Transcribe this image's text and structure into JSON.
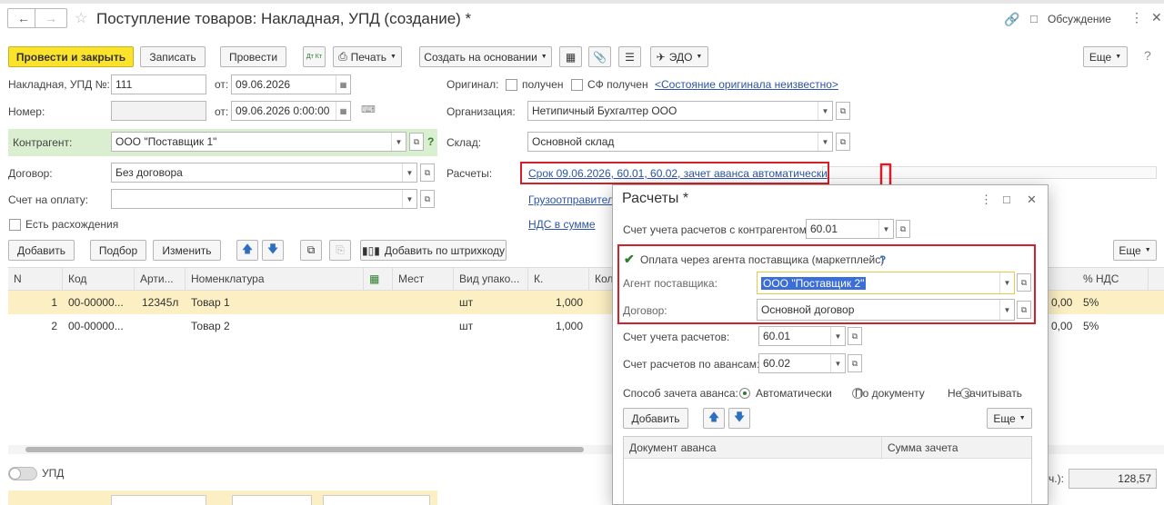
{
  "header": {
    "title": "Поступление товаров: Накладная, УПД (создание) *",
    "discussion": "Обсуждение"
  },
  "toolbar": {
    "post_close": "Провести и закрыть",
    "save": "Записать",
    "post": "Провести",
    "print": "Печать",
    "create_based": "Создать на основании",
    "edo": "ЭДО",
    "more": "Еще",
    "dtkt": "Дт Кт"
  },
  "form": {
    "invoice_label": "Накладная, УПД №:",
    "invoice_value": "111",
    "from_label": "от:",
    "invoice_date": "09.06.2026",
    "number_label": "Номер:",
    "number_value": "",
    "number_date": "09.06.2026  0:00:00",
    "original_label": "Оригинал:",
    "received_label": "получен",
    "sf_received_label": "СФ получен",
    "original_state_link": "<Состояние оригинала неизвестно>",
    "org_label": "Организация:",
    "org_value": "Нетипичный Бухгалтер ООО",
    "counterparty_label": "Контрагент:",
    "counterparty_value": "ООО \"Поставщик 1\"",
    "warehouse_label": "Склад:",
    "warehouse_value": "Основной склад",
    "contract_label": "Договор:",
    "contract_value": "Без договора",
    "settlements_label": "Расчеты:",
    "settlements_link": "Срок 09.06.2026, 60.01, 60.02, зачет аванса автоматически",
    "pay_account_label": "Счет на оплату:",
    "consignor_link": "Грузоотправител",
    "vat_link": "НДС в сумме",
    "discrepancy_label": "Есть расхождения",
    "upd_label": "УПД",
    "total_suffix": "ч.):",
    "total_value": "128,57"
  },
  "table_toolbar": {
    "add": "Добавить",
    "pick": "Подбор",
    "edit": "Изменить",
    "add_barcode": "Добавить по штрихкоду",
    "more": "Еще"
  },
  "table": {
    "headers": [
      "N",
      "Код",
      "Арти...",
      "Номенклатура",
      "Мест",
      "Вид упако...",
      "К.",
      "Кол",
      "% НДС"
    ],
    "rows": [
      {
        "n": "1",
        "code": "00-00000...",
        "art": "12345л",
        "name": "Товар 1",
        "pack": "шт",
        "qty": "1,000",
        "sum": "0,00",
        "vat": "5%"
      },
      {
        "n": "2",
        "code": "00-00000...",
        "art": "",
        "name": "Товар 2",
        "pack": "шт",
        "qty": "1,000",
        "sum": "0,00",
        "vat": "5%"
      }
    ]
  },
  "modal": {
    "title": "Расчеты *",
    "account_label": "Счет учета расчетов с контрагентом:",
    "account_value": "60.01",
    "agent_checkbox": "Оплата через агента поставщика (маркетплейс)",
    "agent_label": "Агент поставщика:",
    "agent_value": "ООО \"Поставщик 2\"",
    "contract_label": "Договор:",
    "contract_value": "Основной договор",
    "settle_account_label": "Счет учета расчетов:",
    "settle_account_value": "60.01",
    "advance_account_label": "Счет расчетов по авансам:",
    "advance_account_value": "60.02",
    "offset_label": "Способ зачета аванса:",
    "offset_options": [
      "Автоматически",
      "По документу",
      "Не зачитывать"
    ],
    "add": "Добавить",
    "more": "Еще",
    "col_doc": "Документ аванса",
    "col_sum": "Сумма зачета"
  },
  "colors": {
    "accent_yellow": "#fbe22b",
    "highlight_red": "#d4202a",
    "row_selected": "#fcefc3",
    "counterparty_bg": "#d9efcf",
    "link": "#2d55a5"
  }
}
